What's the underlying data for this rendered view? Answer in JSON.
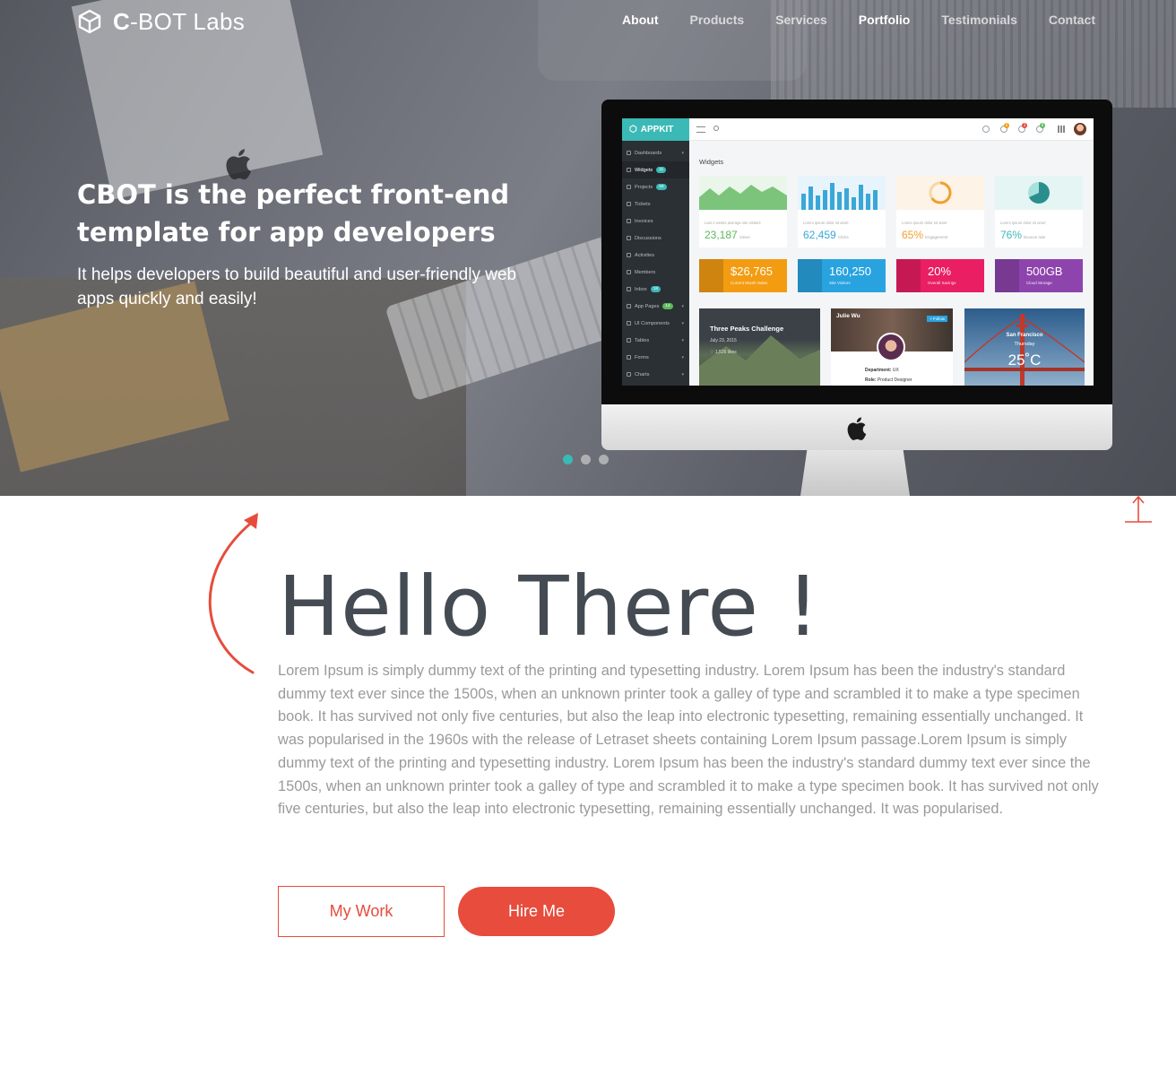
{
  "brand": {
    "bold": "C",
    "rest": "-BOT Labs",
    "icon": "cube-icon"
  },
  "nav": {
    "items": [
      {
        "label": "About"
      },
      {
        "label": "Products"
      },
      {
        "label": "Services"
      },
      {
        "label": "Portfolio"
      },
      {
        "label": "Testimonials"
      },
      {
        "label": "Contact"
      }
    ]
  },
  "hero": {
    "title": "CBOT is the perfect front-end template for app developers",
    "subtitle": "It helps developers to build beautiful and user-friendly web apps quickly and easily!",
    "active_slide": 1,
    "slide_count": 3
  },
  "app": {
    "logo": "APPKIT",
    "heading": "Widgets",
    "menu": [
      {
        "label": "Dashboards",
        "caret": "▾"
      },
      {
        "label": "Widgets",
        "badge": "11"
      },
      {
        "label": "Projects",
        "badge": "56"
      },
      {
        "label": "Tickets"
      },
      {
        "label": "Invoices"
      },
      {
        "label": "Discussions"
      },
      {
        "label": "Activities"
      },
      {
        "label": "Members"
      },
      {
        "label": "Inbox",
        "badge": "18"
      },
      {
        "label": "App Pages",
        "badge": "14",
        "caret": "▾"
      },
      {
        "label": "UI Components",
        "caret": "▾"
      },
      {
        "label": "Tables",
        "caret": "▾"
      },
      {
        "label": "Forms",
        "caret": "▾"
      },
      {
        "label": "Charts",
        "caret": "▾"
      }
    ],
    "top_badges": [
      "6",
      "3",
      "8"
    ],
    "widgets": [
      {
        "small": "Last 2 weeks average site visitors",
        "value": "23,187",
        "unit": "Views",
        "color": "#5cb85c"
      },
      {
        "small": "Lorem ipsum dolor sit amet",
        "value": "62,459",
        "unit": "Clicks",
        "color": "#3aa7d8"
      },
      {
        "small": "Lorem ipsum dolor sit amet",
        "value": "65%",
        "unit": "Engagement",
        "color": "#f0a030"
      },
      {
        "small": "Lorem ipsum dolor sit amet",
        "value": "76%",
        "unit": "Bounce rate",
        "color": "#3bb9b6"
      }
    ],
    "stats": [
      {
        "value": "$26,765",
        "label": "Current Month Sales",
        "color": "#f39c12"
      },
      {
        "value": "160,250",
        "label": "Site Visitors",
        "color": "#29a3df"
      },
      {
        "value": "20%",
        "label": "Overall Savings",
        "color": "#e91e63"
      },
      {
        "value": "500GB",
        "label": "Cloud Storage",
        "color": "#8e44ad"
      }
    ],
    "panel1": {
      "title": "Three Peaks Challenge",
      "date": "July 23, 2015",
      "likes": "♡ 1,526 likes"
    },
    "panel2": {
      "name": "Julie Wu",
      "follow": "+ Follow",
      "dept_label": "Department:",
      "dept": "UX",
      "role_label": "Role:",
      "role": "Product Designer"
    },
    "panel3": {
      "city": "San Francisco",
      "day": "Thursday",
      "temp": "25˚C"
    }
  },
  "intro": {
    "heading": "Hello There !",
    "body": "Lorem Ipsum is simply dummy text of the printing and typesetting industry. Lorem Ipsum has been the industry's standard dummy text ever since the 1500s, when an unknown printer took a galley of type and scrambled it to make a type specimen book. It has survived not only five centuries, but also the leap into electronic typesetting, remaining essentially unchanged. It was popularised in the 1960s with the release of Letraset sheets containing Lorem Ipsum passage.Lorem Ipsum is simply dummy text of the printing and typesetting industry. Lorem Ipsum has been the industry's standard dummy text ever since the 1500s, when an unknown printer took a galley of type and scrambled it to make a type specimen book. It has survived not only five centuries, but also the leap into electronic typesetting, remaining essentially unchanged. It was popularised.",
    "btn_work": "My Work",
    "btn_hire": "Hire Me"
  },
  "colors": {
    "accent": "#e74c3c",
    "teal": "#3bb9b6",
    "heading": "#454b53"
  }
}
